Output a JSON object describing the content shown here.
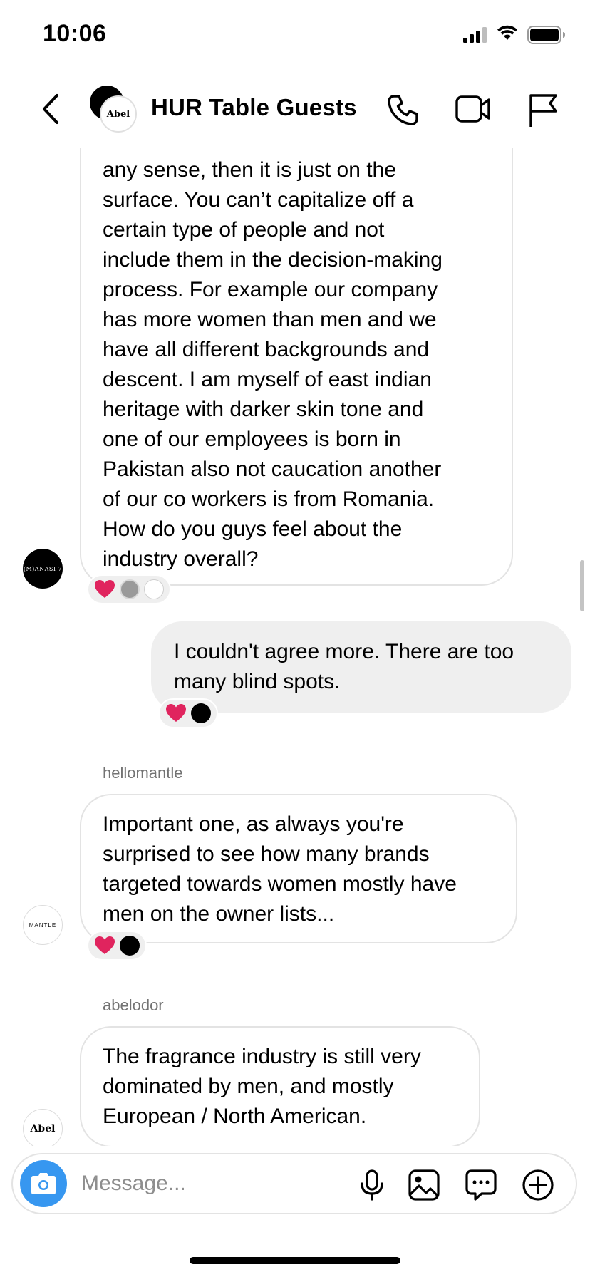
{
  "status_bar": {
    "time": "10:06"
  },
  "header": {
    "title": "HUR Table Guests",
    "group_avatar_text": "Abel",
    "icons": [
      "back-icon",
      "call-icon",
      "video-icon",
      "flag-icon"
    ]
  },
  "messages": [
    {
      "direction": "incoming",
      "sender": "",
      "avatar_text": "(M)ANASI 7",
      "text": "any sense, then it is just on the\nsurface. You can’t capitalize off a\ncertain type of people and not\ninclude them in the decision-making\nprocess. For example our company\nhas more women than men and we\nhave all different backgrounds and\ndescent. I am myself of east indian\nheritage with darker skin tone and\none of our employees is born in\nPakistan also not caucation another\nof our co workers is from Romania.\nHow do you guys feel about the\nindustry overall?",
      "reactions": [
        "heart",
        "gray-avatar",
        "white-avatar"
      ]
    },
    {
      "direction": "outgoing",
      "text": "I couldn't agree more. There are too\nmany blind spots.",
      "reactions": [
        "heart",
        "black-avatar"
      ]
    },
    {
      "direction": "incoming",
      "sender": "hellomantle",
      "avatar_text": "MANTLE",
      "text": "Important one, as always you're\nsurprised to see how many brands\ntargeted towards women mostly have\nmen on the owner lists...",
      "reactions": [
        "heart",
        "black-avatar"
      ]
    },
    {
      "direction": "incoming",
      "sender": "abelodor",
      "avatar_text": "Abel",
      "text": "The fragrance industry is still very\ndominated by men, and mostly\nEuropean / North American.",
      "reactions": []
    }
  ],
  "composer": {
    "placeholder": "Message...",
    "icons": [
      "camera-icon",
      "microphone-icon",
      "gallery-icon",
      "sticker-icon",
      "plus-icon"
    ],
    "accent_color": "#3797f0"
  },
  "colors": {
    "incoming_border": "#e3e3e3",
    "outgoing_bg": "#efefef",
    "sender_label": "#737373",
    "heart": "#e0245e"
  }
}
